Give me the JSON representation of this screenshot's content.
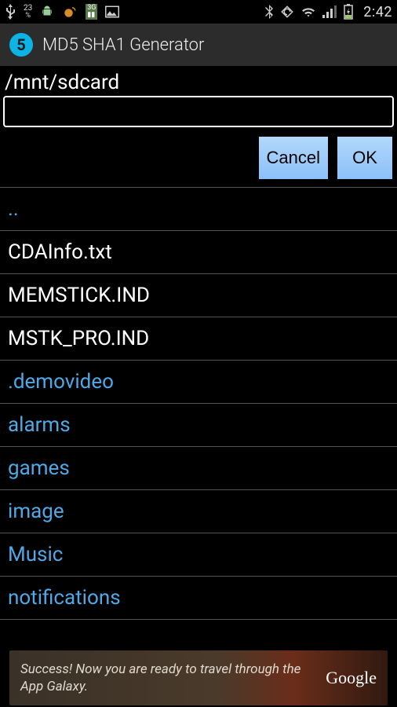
{
  "status": {
    "battery_percent": "23",
    "time": "2:42"
  },
  "app": {
    "icon_glyph": "5",
    "title": "MD5 SHA1 Generator"
  },
  "browser": {
    "path_label": "/mnt/sdcard",
    "input_value": "",
    "cancel_label": "Cancel",
    "ok_label": "OK"
  },
  "files": [
    {
      "name": "..",
      "type": "dir"
    },
    {
      "name": "CDAInfo.txt",
      "type": "file"
    },
    {
      "name": "MEMSTICK.IND",
      "type": "file"
    },
    {
      "name": "MSTK_PRO.IND",
      "type": "file"
    },
    {
      "name": ".demovideo",
      "type": "dir"
    },
    {
      "name": "alarms",
      "type": "dir"
    },
    {
      "name": "games",
      "type": "dir"
    },
    {
      "name": "image",
      "type": "dir"
    },
    {
      "name": "Music",
      "type": "dir"
    },
    {
      "name": "notifications",
      "type": "dir"
    }
  ],
  "ad": {
    "text": "Success! Now you are ready to travel through the App Galaxy.",
    "brand": "Google"
  }
}
